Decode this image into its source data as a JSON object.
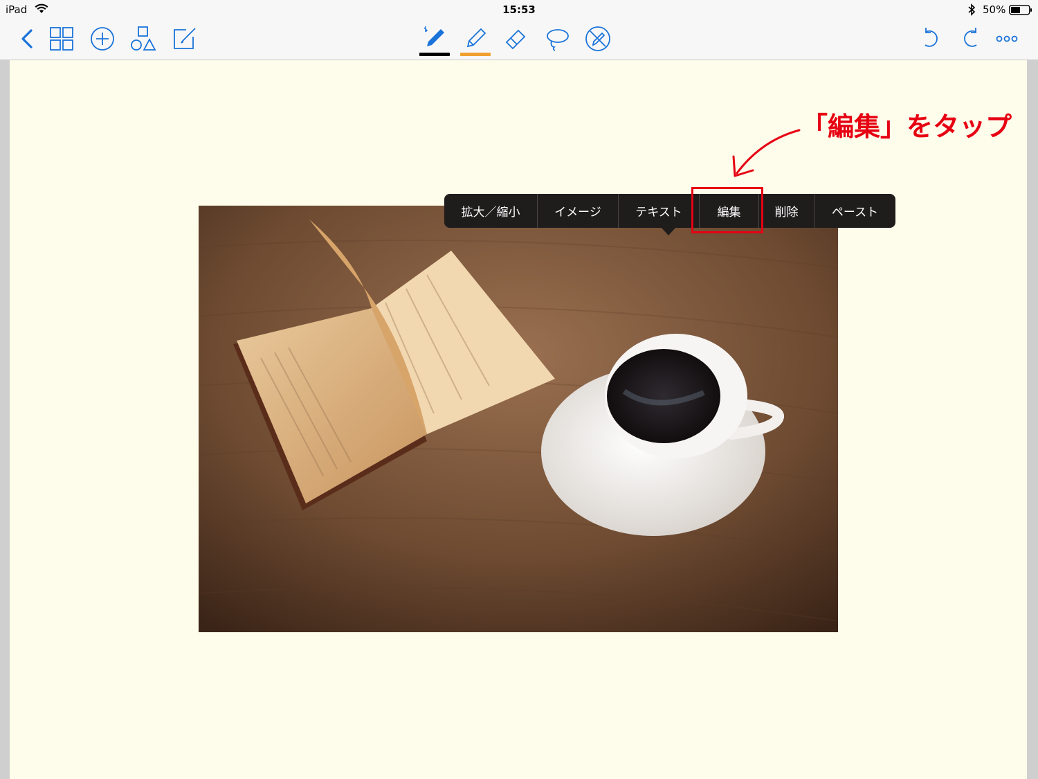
{
  "status_bar": {
    "device": "iPad",
    "time": "15:53",
    "battery": "50%"
  },
  "toolbar": {
    "left_icons": [
      "back-chevron-icon",
      "grid-icon",
      "add-circle-icon",
      "shapes-icon",
      "compose-icon"
    ],
    "center_tools": [
      {
        "name": "pen-tool",
        "underline_color": "#000000"
      },
      {
        "name": "highlighter-tool",
        "underline_color": "#f0a030"
      },
      {
        "name": "eraser-tool"
      },
      {
        "name": "lasso-tool"
      },
      {
        "name": "pen-disable-tool"
      }
    ],
    "right_icons": [
      "undo-icon",
      "redo-icon",
      "more-icon"
    ],
    "accent": "#1a73d9"
  },
  "context_menu": {
    "items": [
      "拡大／縮小",
      "イメージ",
      "テキスト",
      "編集",
      "削除",
      "ペースト"
    ],
    "highlighted_index": 3
  },
  "annotation": {
    "text": "「編集」をタップ",
    "color": "#e60012"
  },
  "page": {
    "background": "#fefcea"
  }
}
